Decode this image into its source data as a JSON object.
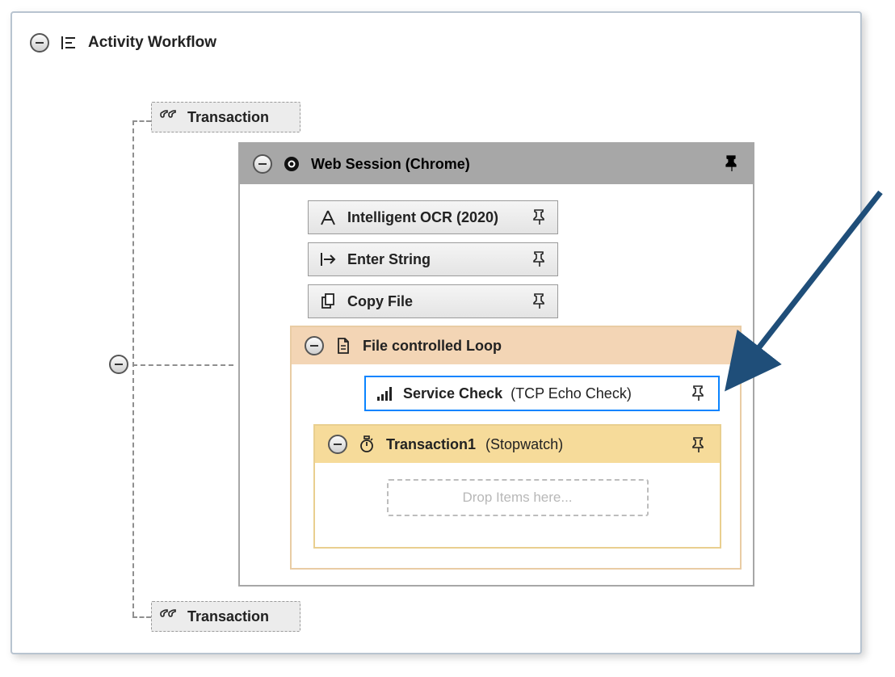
{
  "root": {
    "title": "Activity Workflow"
  },
  "placeholders": {
    "top_label": "Transaction",
    "bottom_label": "Transaction"
  },
  "session": {
    "title": "Web Session (Chrome)",
    "children": [
      {
        "label": "Intelligent OCR (2020)"
      },
      {
        "label": "Enter String"
      },
      {
        "label": "Copy File"
      }
    ]
  },
  "loop": {
    "title": "File controlled Loop",
    "selected": {
      "label": "Service Check",
      "sub": "(TCP Echo Check)"
    },
    "txn": {
      "label": "Transaction1",
      "sub": "(Stopwatch)",
      "dropzone": "Drop Items here..."
    }
  }
}
